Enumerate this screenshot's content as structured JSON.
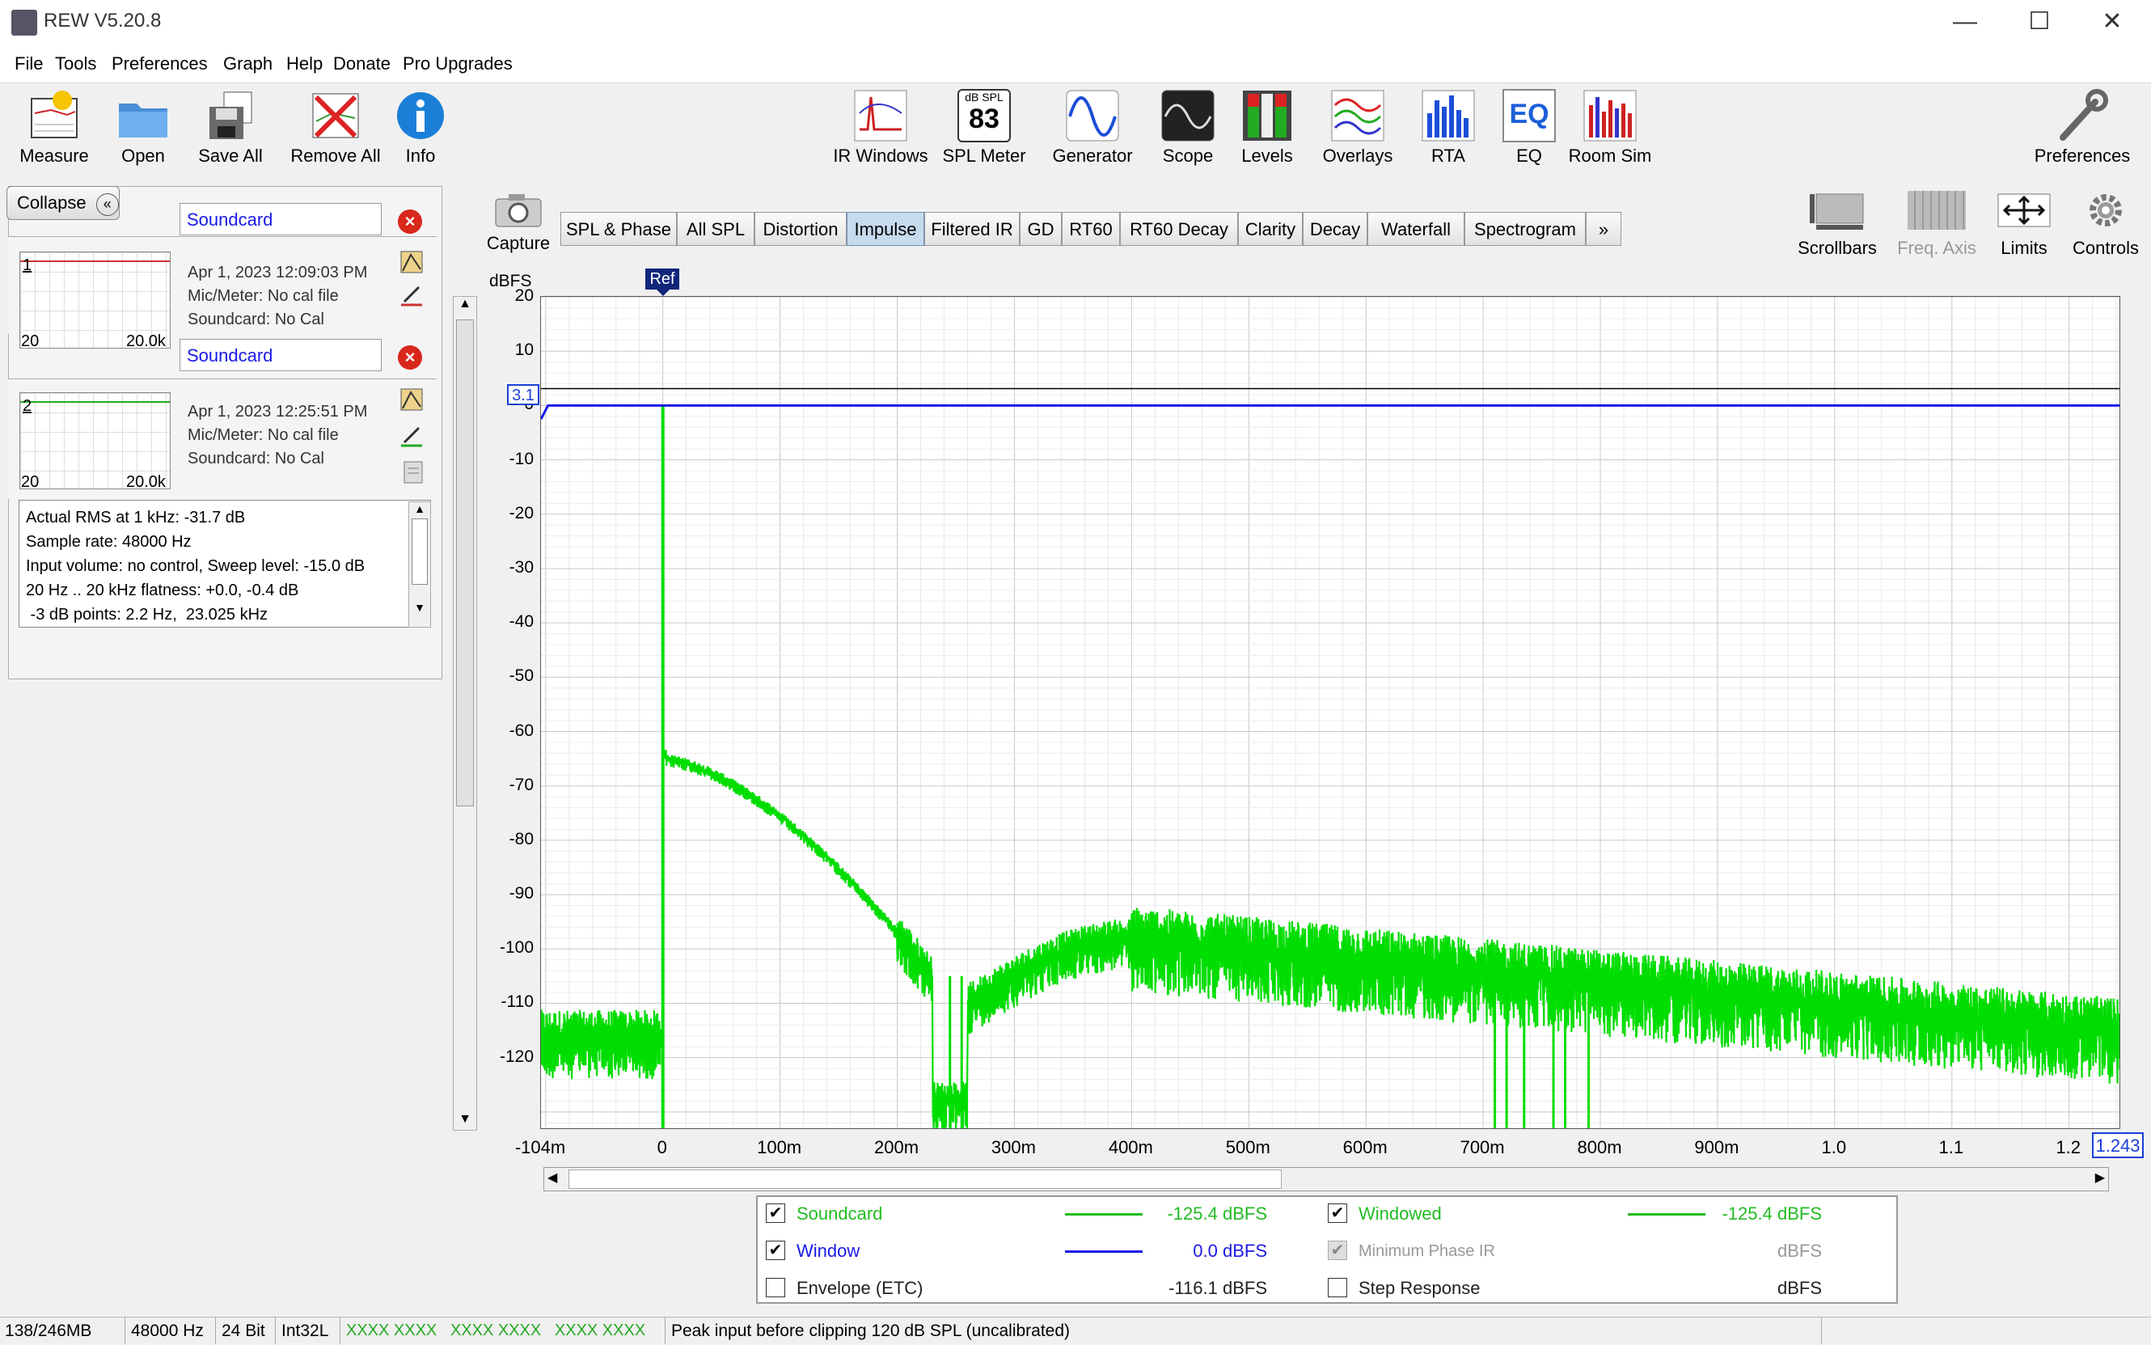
{
  "window": {
    "title": "REW V5.20.8",
    "controls": [
      "—",
      "☐",
      "✕"
    ]
  },
  "menu": [
    "File",
    "Tools",
    "Preferences",
    "Graph",
    "Help",
    "Donate",
    "Pro Upgrades"
  ],
  "toolbar_left": [
    {
      "label": "Measure",
      "icon": "measure-icon"
    },
    {
      "label": "Open",
      "icon": "folder-icon"
    },
    {
      "label": "Save All",
      "icon": "save-all-icon"
    },
    {
      "label": "Remove All",
      "icon": "remove-all-icon"
    },
    {
      "label": "Info",
      "icon": "info-icon"
    }
  ],
  "toolbar_center": [
    {
      "label": "IR Windows",
      "icon": "ir-windows-icon"
    },
    {
      "label": "SPL Meter",
      "icon": "spl-meter-icon",
      "badge_top": "dB SPL",
      "badge_value": "83"
    },
    {
      "label": "Generator",
      "icon": "generator-icon"
    },
    {
      "label": "Scope",
      "icon": "scope-icon"
    },
    {
      "label": "Levels",
      "icon": "levels-icon"
    },
    {
      "label": "Overlays",
      "icon": "overlays-icon"
    },
    {
      "label": "RTA",
      "icon": "rta-icon"
    },
    {
      "label": "EQ",
      "icon": "eq-icon"
    },
    {
      "label": "Room Sim",
      "icon": "room-sim-icon"
    }
  ],
  "toolbar_right": {
    "label": "Preferences",
    "icon": "wrench-icon"
  },
  "left_panel": {
    "collapse_label": "Collapse",
    "measurements": [
      {
        "index": "1",
        "name": "Soundcard",
        "date": "Apr 1, 2023 12:09:03 PM",
        "mic": "Mic/Meter: No cal file",
        "soundcard": "Soundcard: No Cal",
        "thumb_x_min": "20",
        "thumb_x_max": "20.0k",
        "trace_color": "#cc3333"
      },
      {
        "index": "2",
        "name": "Soundcard",
        "date": "Apr 1, 2023 12:25:51 PM",
        "mic": "Mic/Meter: No cal file",
        "soundcard": "Soundcard: No Cal",
        "thumb_x_min": "20",
        "thumb_x_max": "20.0k",
        "trace_color": "#22aa22"
      }
    ],
    "info_lines": [
      "Actual RMS at 1 kHz: -31.7 dB",
      "Sample rate: 48000 Hz",
      "Input volume: no control, Sweep level: -15.0 dB",
      "20 Hz .. 20 kHz flatness: +0.0, -0.4 dB",
      " -3 dB points: 2.2 Hz,  23.025 kHz"
    ],
    "hidden_fragment": "Actual RMS"
  },
  "capture": {
    "label": "Capture",
    "icon": "camera-icon"
  },
  "tabs": [
    "SPL & Phase",
    "All SPL",
    "Distortion",
    "Impulse",
    "Filtered IR",
    "GD",
    "RT60",
    "RT60 Decay",
    "Clarity",
    "Decay",
    "Waterfall",
    "Spectrogram",
    "»"
  ],
  "active_tab": "Impulse",
  "right_controls": [
    {
      "label": "Scrollbars",
      "icon": "scrollbars-icon",
      "enabled": true
    },
    {
      "label": "Freq. Axis",
      "icon": "freq-axis-icon",
      "enabled": false
    },
    {
      "label": "Limits",
      "icon": "limits-icon",
      "enabled": true
    },
    {
      "label": "Controls",
      "icon": "gear-icon",
      "enabled": true
    }
  ],
  "graph": {
    "y_unit": "dBFS",
    "y_ticks": [
      "20",
      "10",
      "0",
      "-10",
      "-20",
      "-30",
      "-40",
      "-50",
      "-60",
      "-70",
      "-80",
      "-90",
      "-100",
      "-110",
      "-120"
    ],
    "x_ticks": [
      "-104m",
      "0",
      "100m",
      "200m",
      "300m",
      "400m",
      "500m",
      "600m",
      "700m",
      "800m",
      "900m",
      "1.0",
      "1.1",
      "1.2"
    ],
    "x_end_label": "1.243",
    "y_cursor_label": "3.1",
    "ref_marker": "Ref",
    "colors": {
      "soundcard": "#00dd00",
      "window": "#1a1ae6",
      "cursor": "#000000"
    }
  },
  "legend": {
    "rows": [
      {
        "checked": true,
        "name": "Soundcard",
        "color": "#22bb22",
        "line": true,
        "value": "-125.4 dBFS",
        "enabled": true
      },
      {
        "checked": true,
        "name": "Window",
        "color": "#1a1ae6",
        "line": true,
        "value": "0.0 dBFS",
        "enabled": true
      },
      {
        "checked": false,
        "name": "Envelope (ETC)",
        "color": "#000000",
        "line": false,
        "value": "-116.1 dBFS",
        "enabled": true
      }
    ],
    "rows_right": [
      {
        "checked": true,
        "name": "Windowed",
        "color": "#22bb22",
        "line": true,
        "value": "-125.4 dBFS",
        "enabled": true
      },
      {
        "checked": true,
        "name": "Minimum Phase IR",
        "color": "#999999",
        "line": false,
        "value": "dBFS",
        "enabled": false
      },
      {
        "checked": false,
        "name": "Step Response",
        "color": "#000000",
        "line": false,
        "value": "dBFS",
        "enabled": true
      }
    ]
  },
  "status": {
    "memory": "138/246MB",
    "rate": "48000 Hz",
    "bits": "24 Bit",
    "format": "Int32L",
    "meters": "XXXX XXXX   XXXX XXXX   XXXX XXXX",
    "message": "Peak input before clipping 120 dB SPL (uncalibrated)"
  }
}
